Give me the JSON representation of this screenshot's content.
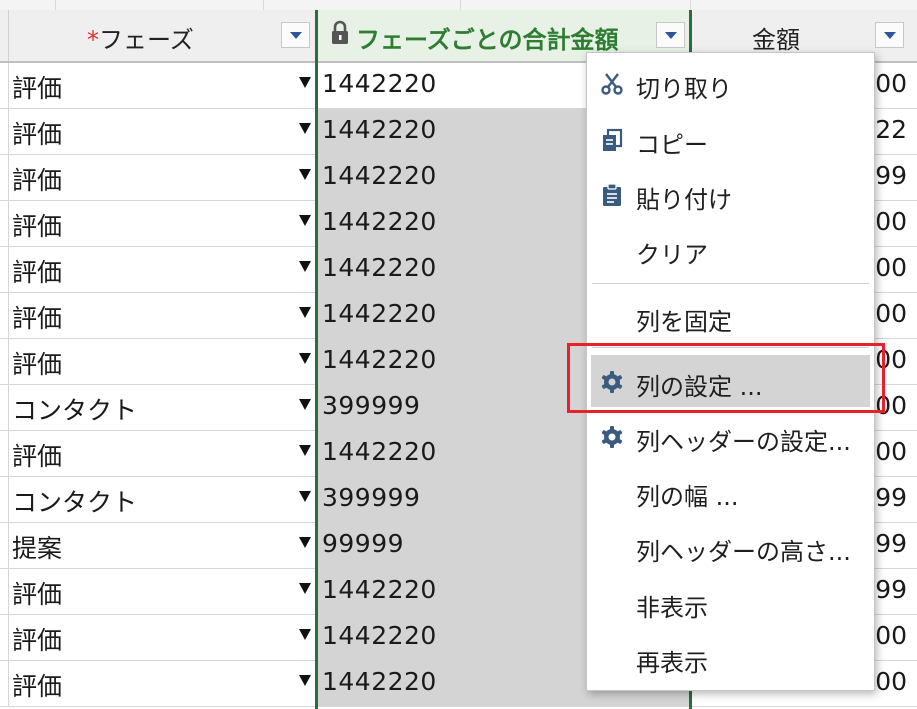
{
  "columns": {
    "phase": {
      "required_mark": "*",
      "label": "フェーズ"
    },
    "total": {
      "label": "フェーズごとの合計金額"
    },
    "amount": {
      "label": "金額"
    }
  },
  "rows": [
    {
      "phase": "評価",
      "total": "1442220",
      "amount": "00"
    },
    {
      "phase": "評価",
      "total": "1442220",
      "amount": "22"
    },
    {
      "phase": "評価",
      "total": "1442220",
      "amount": "99"
    },
    {
      "phase": "評価",
      "total": "1442220",
      "amount": "00"
    },
    {
      "phase": "評価",
      "total": "1442220",
      "amount": "00"
    },
    {
      "phase": "評価",
      "total": "1442220",
      "amount": "00"
    },
    {
      "phase": "評価",
      "total": "1442220",
      "amount": "00"
    },
    {
      "phase": "コンタクト",
      "total": "399999",
      "amount": "00"
    },
    {
      "phase": "評価",
      "total": "1442220",
      "amount": "00"
    },
    {
      "phase": "コンタクト",
      "total": "399999",
      "amount": "99"
    },
    {
      "phase": "提案",
      "total": "99999",
      "amount": "99"
    },
    {
      "phase": "評価",
      "total": "1442220",
      "amount": "99"
    },
    {
      "phase": "評価",
      "total": "1442220",
      "amount": "00"
    },
    {
      "phase": "評価",
      "total": "1442220",
      "amount": "00"
    }
  ],
  "context_menu": {
    "cut": "切り取り",
    "copy": "コピー",
    "paste": "貼り付け",
    "clear": "クリア",
    "freeze": "列を固定",
    "column_settings": "列の設定 ...",
    "header_settings": "列ヘッダーの設定...",
    "width": "列の幅 ...",
    "header_height": "列ヘッダーの高さ...",
    "hide": "非表示",
    "unhide": "再表示"
  },
  "colors": {
    "locked_header_text": "#2e7d32",
    "highlight_box": "#e8202a",
    "dropdown_arrow": "#2b579a"
  },
  "icons": {
    "cut": "scissors-icon",
    "copy": "copy-icon",
    "paste": "clipboard-icon",
    "settings": "gear-icon",
    "lock": "lock-icon"
  }
}
